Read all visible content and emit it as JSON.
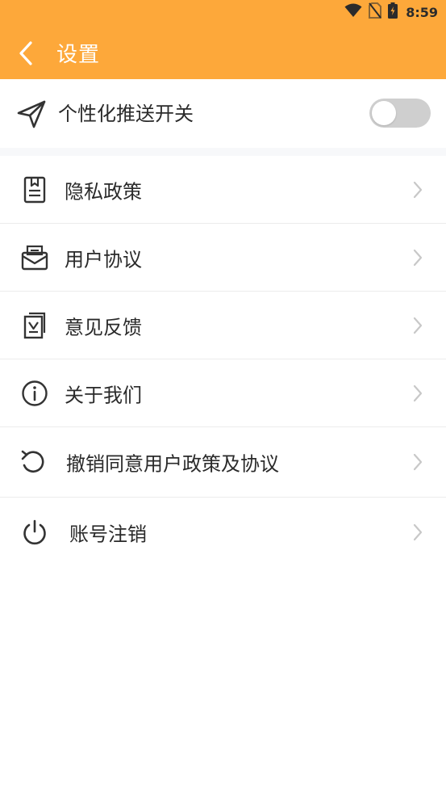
{
  "status_bar": {
    "time": "8:59",
    "icons": [
      "wifi-icon",
      "no-sim-icon",
      "battery-charging-icon"
    ]
  },
  "header": {
    "title": "设置",
    "background_color": "#FDA83A",
    "back_icon": "chevron-left-icon"
  },
  "push_toggle": {
    "label": "个性化推送开关",
    "icon": "paper-plane-icon",
    "enabled": false
  },
  "menu": {
    "items": [
      {
        "label": "隐私政策",
        "icon": "document-icon"
      },
      {
        "label": "用户协议",
        "icon": "mail-tray-icon"
      },
      {
        "label": "意见反馈",
        "icon": "feedback-icon"
      },
      {
        "label": "关于我们",
        "icon": "info-icon"
      },
      {
        "label": "撤销同意用户政策及协议",
        "icon": "undo-icon"
      },
      {
        "label": "账号注销",
        "icon": "power-icon"
      }
    ]
  },
  "colors": {
    "accent": "#FDA83A",
    "text": "#2a2a2a",
    "switch_off": "#cfcfcf",
    "chevron": "#c8c8c8",
    "icon": "#333333"
  }
}
